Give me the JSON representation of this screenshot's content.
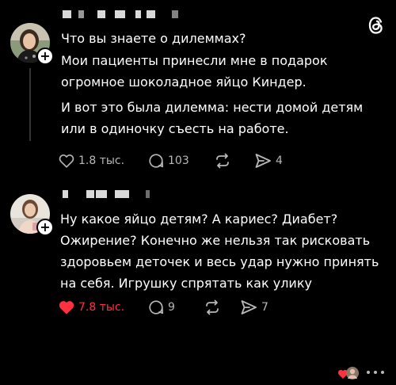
{
  "colors": {
    "background": "#000000",
    "text": "#ffffff",
    "muted": "#b8b8b8",
    "liked": "#ff3040",
    "thread_line": "#333333"
  },
  "app": {
    "logo_icon": "threads-logo-icon"
  },
  "posts": [
    {
      "text_lines": [
        "Что вы знаете о дилеммах?",
        "Мои пациенты принесли мне в подарок",
        "огромное шоколадное яйцо Киндер.",
        "И вот это была дилемма: нести домой детям",
        "или в одиночку съесть на работе."
      ],
      "likes": "1.8 тыс.",
      "replies": "103",
      "reposts": "",
      "shares": "4",
      "liked": false
    },
    {
      "text_lines": [
        "Ну какое яйцо детям? А кариес? Диабет?",
        "Ожирение? Конечно же нельзя так рисковать",
        "здоровьем деточек и весь удар нужно принять",
        "на себя. Игрушку спрятать как улику"
      ],
      "likes": "7.8 тыс.",
      "replies": "9",
      "reposts": "",
      "shares": "7",
      "liked": true
    }
  ]
}
